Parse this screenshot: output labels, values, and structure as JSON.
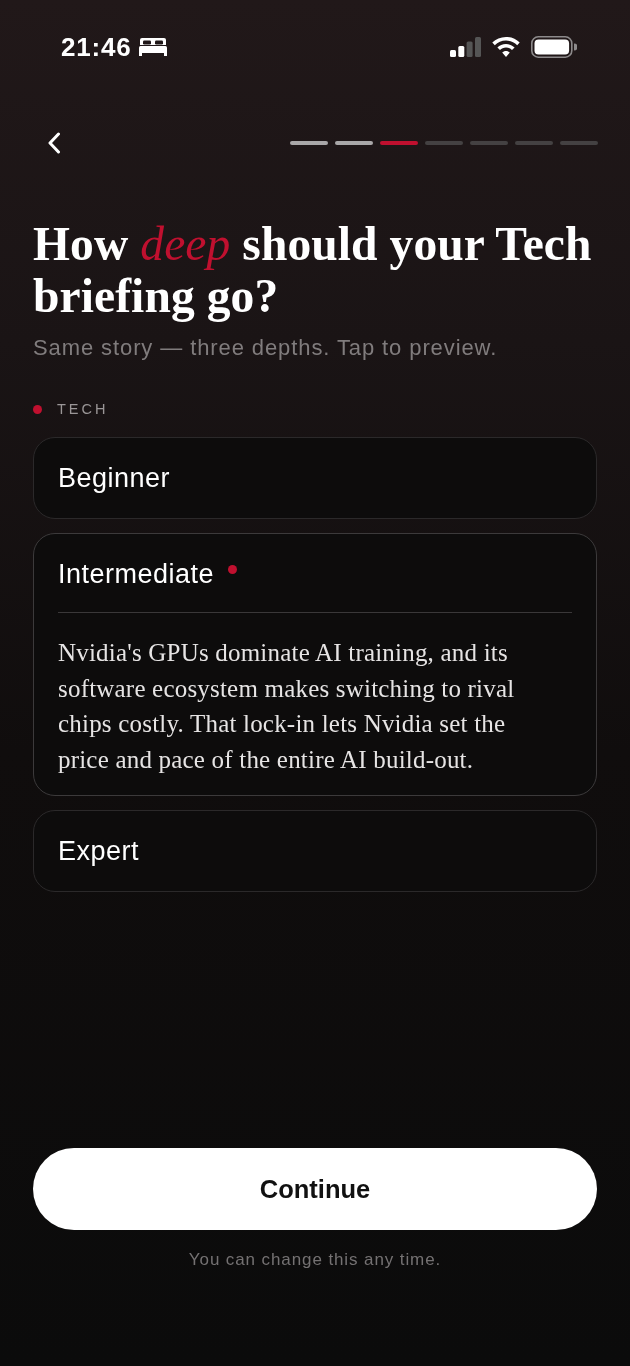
{
  "status_bar": {
    "time": "21:46"
  },
  "header": {
    "steps": [
      {
        "completed": true,
        "selected": false
      },
      {
        "completed": true,
        "selected": false
      },
      {
        "completed": false,
        "selected": true
      },
      {
        "completed": false,
        "selected": false
      },
      {
        "completed": false,
        "selected": false
      },
      {
        "completed": false,
        "selected": false
      },
      {
        "completed": false,
        "selected": false
      }
    ]
  },
  "title": "How *deep* should your Tech briefing go?",
  "subtitle": "Same story — three depths. Tap to preview.",
  "section_label": "TECH",
  "options": [
    {
      "label": "Beginner",
      "selected": false,
      "expanded": false
    },
    {
      "label": "Intermediate",
      "selected": true,
      "expanded": true,
      "preview": "Nvidia's GPUs dominate AI training, and its software ecosystem makes switching to rival chips costly. That lock-in lets Nvidia set the price and pace of the entire AI build-out."
    },
    {
      "label": "Expert",
      "selected": false,
      "expanded": false
    }
  ],
  "button": "Continue",
  "footnote": "You can change this any time."
}
